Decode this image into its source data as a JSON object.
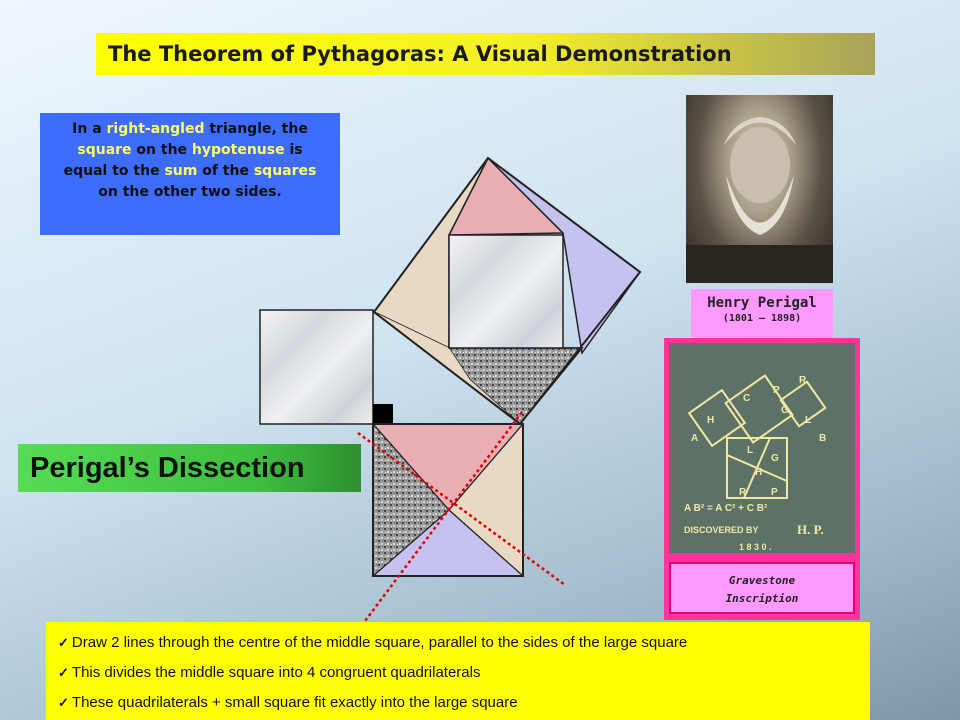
{
  "title": "The Theorem of Pythagoras: A Visual Demonstration",
  "theorem": {
    "parts": [
      {
        "text": "In a ",
        "highlight": false
      },
      {
        "text": "right-angled",
        "highlight": true
      },
      {
        "text": " triangle, the ",
        "highlight": false
      },
      {
        "text": "square",
        "highlight": true
      },
      {
        "text": " on the ",
        "highlight": false
      },
      {
        "text": "hypotenuse",
        "highlight": true
      },
      {
        "text": " is equal to the ",
        "highlight": false
      },
      {
        "text": "sum",
        "highlight": true
      },
      {
        "text": " of the ",
        "highlight": false
      },
      {
        "text": "squares",
        "highlight": true
      },
      {
        "text": " on the other two sides.",
        "highlight": false
      }
    ]
  },
  "portrait": {
    "name": "Henry Perigal",
    "dates": "(1801 – 1898)"
  },
  "gravestone": {
    "caption_line1": "Gravestone",
    "caption_line2": "Inscription",
    "formula": "A B² = A C² + C B²",
    "discovered": "DISCOVERED BY",
    "initials": "H. P.",
    "year": "1 8 3 0 .",
    "labels": [
      "H",
      "C",
      "P",
      "R",
      "G",
      "L",
      "A",
      "B",
      "L",
      "G",
      "H",
      "R",
      "P"
    ]
  },
  "section_label": "Perigal’s Dissection",
  "bullets": [
    "Draw 2 lines through the centre of the middle square, parallel to the sides of the large square",
    "This divides the middle square into 4 congruent quadrilaterals",
    "These quadrilaterals + small square fit exactly into the large square"
  ],
  "colors": {
    "title_bg": "#ffff00",
    "theorem_bg": "#3d6cff",
    "highlight": "#ffff66",
    "pink_piece": "#e8aeb4",
    "beige_piece": "#e8d8c4",
    "lavender_piece": "#c6c2f0",
    "marble": "#e4e6ea",
    "granite": "#8a8a8a",
    "cut_line": "#dd0000",
    "section_bg": "#44cc44",
    "bullets_bg": "#ffff00",
    "frame": "#ff3399",
    "caption_bg": "#ff99ff"
  }
}
